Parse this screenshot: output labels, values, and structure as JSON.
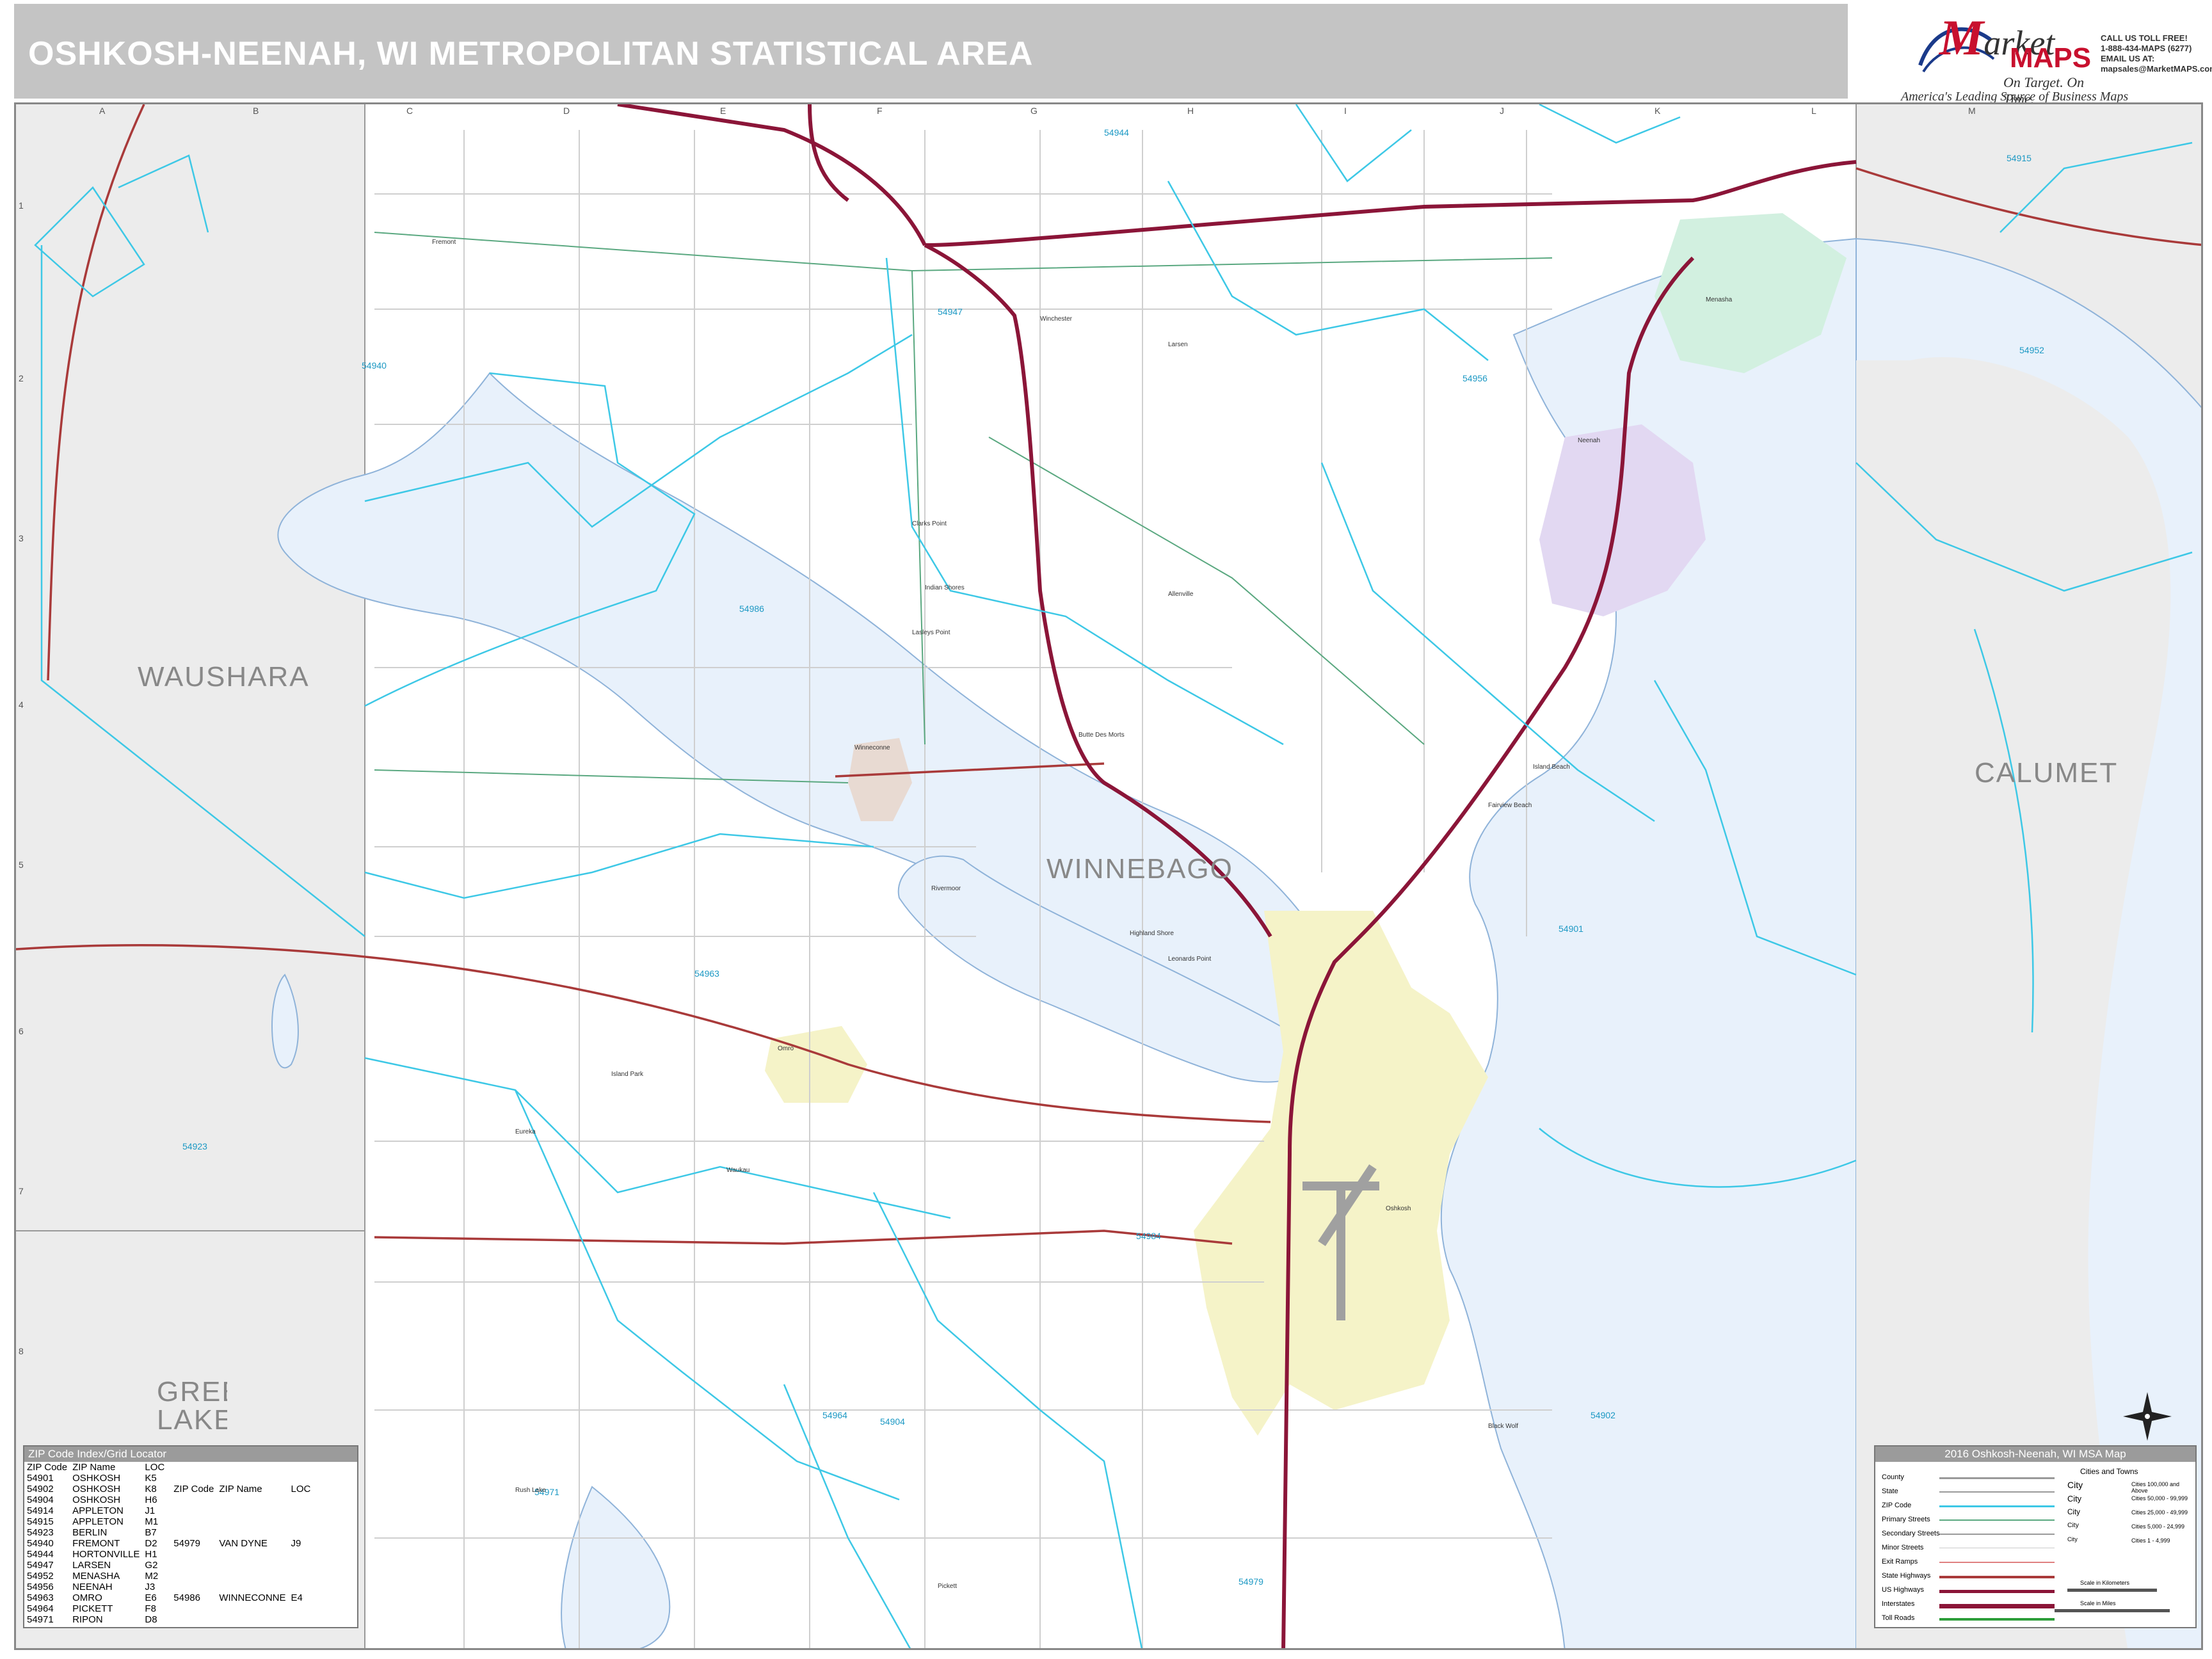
{
  "header": {
    "title": "OSHKOSH-NEENAH, WI METROPOLITAN STATISTICAL AREA"
  },
  "brand": {
    "logo_m": "M",
    "logo_market": "arket",
    "logo_maps": "MAPS",
    "tagline": "On Target. On Time.",
    "slogan": "America's Leading Source of Business Maps"
  },
  "contact": {
    "line1": "CALL US TOLL FREE!",
    "line2": "1-888-434-MAPS (6277)",
    "line3": "EMAIL US AT:",
    "line4": "mapsales@MarketMAPS.com"
  },
  "grid": {
    "letters": [
      "A",
      "B",
      "C",
      "D",
      "E",
      "F",
      "G",
      "H",
      "I",
      "J",
      "K",
      "L",
      "M"
    ],
    "numbers": [
      "1",
      "2",
      "3",
      "4",
      "5",
      "6",
      "7",
      "8"
    ]
  },
  "counties": [
    {
      "name": "WAUSHARA"
    },
    {
      "name": "WINNEBAGO"
    },
    {
      "name": "CALUMET"
    },
    {
      "name": "GREEN LAKE"
    }
  ],
  "zip_labels": [
    "54944",
    "54915",
    "54947",
    "54940",
    "54956",
    "54952",
    "54986",
    "54963",
    "54901",
    "54923",
    "54904",
    "54964",
    "54902",
    "54971",
    "54979",
    "54984"
  ],
  "places": [
    "Oshkosh",
    "Neenah",
    "Menasha",
    "Omro",
    "Winneconne",
    "Butte Des Morts",
    "Larsen",
    "Fremont",
    "Pickett",
    "Eureka",
    "Waukau",
    "Rush Lake",
    "Black Wolf",
    "Highland Shore",
    "Leonards Point",
    "Clarks Point",
    "Indian Shores",
    "Island Park",
    "Allenville",
    "Winchester",
    "Rivermoor",
    "Island Beach",
    "Fairview Beach",
    "Lasleys Point",
    "Omro"
  ],
  "zip_index": {
    "title": "ZIP Code Index/Grid Locator",
    "headers": [
      "ZIP Code",
      "ZIP Name",
      "LOC"
    ],
    "rows_left": [
      [
        "54901",
        "OSHKOSH",
        "K5"
      ],
      [
        "54902",
        "OSHKOSH",
        "K8"
      ],
      [
        "54904",
        "OSHKOSH",
        "H6"
      ],
      [
        "54914",
        "APPLETON",
        "J1"
      ],
      [
        "54915",
        "APPLETON",
        "M1"
      ],
      [
        "54923",
        "BERLIN",
        "B7"
      ],
      [
        "54940",
        "FREMONT",
        "D2"
      ],
      [
        "54944",
        "HORTONVILLE",
        "H1"
      ],
      [
        "54947",
        "LARSEN",
        "G2"
      ],
      [
        "54952",
        "MENASHA",
        "M2"
      ],
      [
        "54956",
        "NEENAH",
        "J3"
      ],
      [
        "54963",
        "OMRO",
        "E6"
      ],
      [
        "54964",
        "PICKETT",
        "F8"
      ],
      [
        "54971",
        "RIPON",
        "D8"
      ]
    ],
    "rows_right": [
      [
        "54979",
        "VAN DYNE",
        "J9"
      ],
      [
        "54986",
        "WINNECONNE",
        "E4"
      ]
    ]
  },
  "legend": {
    "title": "2016 Oshkosh-Neenah, WI MSA Map",
    "cities_head": "Cities and Towns",
    "rows": [
      "County",
      "State",
      "ZIP Code",
      "Primary Streets",
      "Secondary Streets",
      "Minor Streets",
      "Exit Ramps",
      "State Highways",
      "US Highways",
      "Interstates",
      "Toll Roads"
    ],
    "cities": [
      {
        "name": "City",
        "range": "Cities 100,000 and Above"
      },
      {
        "name": "City",
        "range": "Cities 50,000 - 99,999"
      },
      {
        "name": "City",
        "range": "Cities 25,000 - 49,999"
      },
      {
        "name": "City",
        "range": "Cities 5,000 - 24,999"
      },
      {
        "name": "City",
        "range": "Cities 1 - 4,999"
      }
    ],
    "scale_km": "Scale in Kilometers",
    "scale_mi": "Scale in Miles"
  },
  "compass": {
    "n": "N"
  },
  "colors": {
    "water": "#e8f1fb",
    "zip_line": "#3dc8e6",
    "interstate": "#8b1538",
    "us_highway": "#a93a3a",
    "state_road": "#5aa880",
    "county_fill": "#ececec",
    "oshkosh_fill": "#f5f3c8",
    "neenah_fill": "#e2d8f2",
    "menasha_fill": "#d2f0e0"
  }
}
